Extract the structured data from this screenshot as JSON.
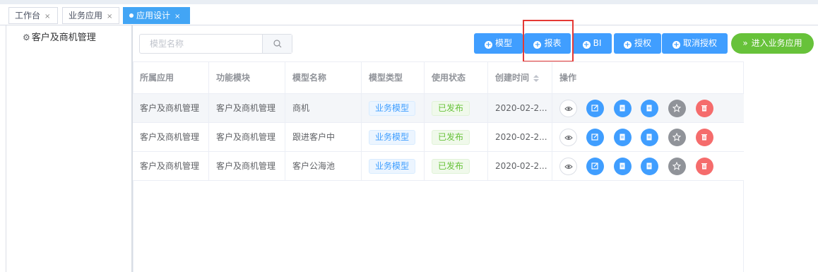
{
  "tabs": [
    {
      "label": "工作台",
      "close": "×",
      "active": false
    },
    {
      "label": "业务应用",
      "close": "×",
      "active": false
    },
    {
      "label": "应用设计",
      "close": "×",
      "active": true
    }
  ],
  "tree": {
    "node_label": "客户及商机管理",
    "icon": "gear-icon"
  },
  "search": {
    "placeholder": "模型名称",
    "icon": "search-icon"
  },
  "toolbar": {
    "model_label": "模型",
    "report_label": "报表",
    "bi_label": "BI",
    "grant_label": "授权",
    "revoke_label": "取消授权",
    "enter_label": "进入业务应用",
    "enter_icon": "double-chevron-right-icon"
  },
  "table": {
    "headers": [
      "所属应用",
      "功能模块",
      "模型名称",
      "模型类型",
      "使用状态",
      "创建时间",
      "操作"
    ],
    "rows": [
      {
        "app": "客户及商机管理",
        "module": "客户及商机管理",
        "name": "商机",
        "type": "业务模型",
        "status": "已发布",
        "created": "2020-02-2..."
      },
      {
        "app": "客户及商机管理",
        "module": "客户及商机管理",
        "name": "跟进客户中",
        "type": "业务模型",
        "status": "已发布",
        "created": "2020-02-2..."
      },
      {
        "app": "客户及商机管理",
        "module": "客户及商机管理",
        "name": "客户公海池",
        "type": "业务模型",
        "status": "已发布",
        "created": "2020-02-2..."
      }
    ],
    "row_actions": [
      "eye-icon",
      "edit-icon",
      "document-icon",
      "document-icon",
      "star-icon",
      "delete-icon"
    ]
  },
  "colors": {
    "primary": "#409eff",
    "success": "#67c23a",
    "danger": "#f56c6c",
    "info": "#909399",
    "highlight_box": "#e53935"
  }
}
